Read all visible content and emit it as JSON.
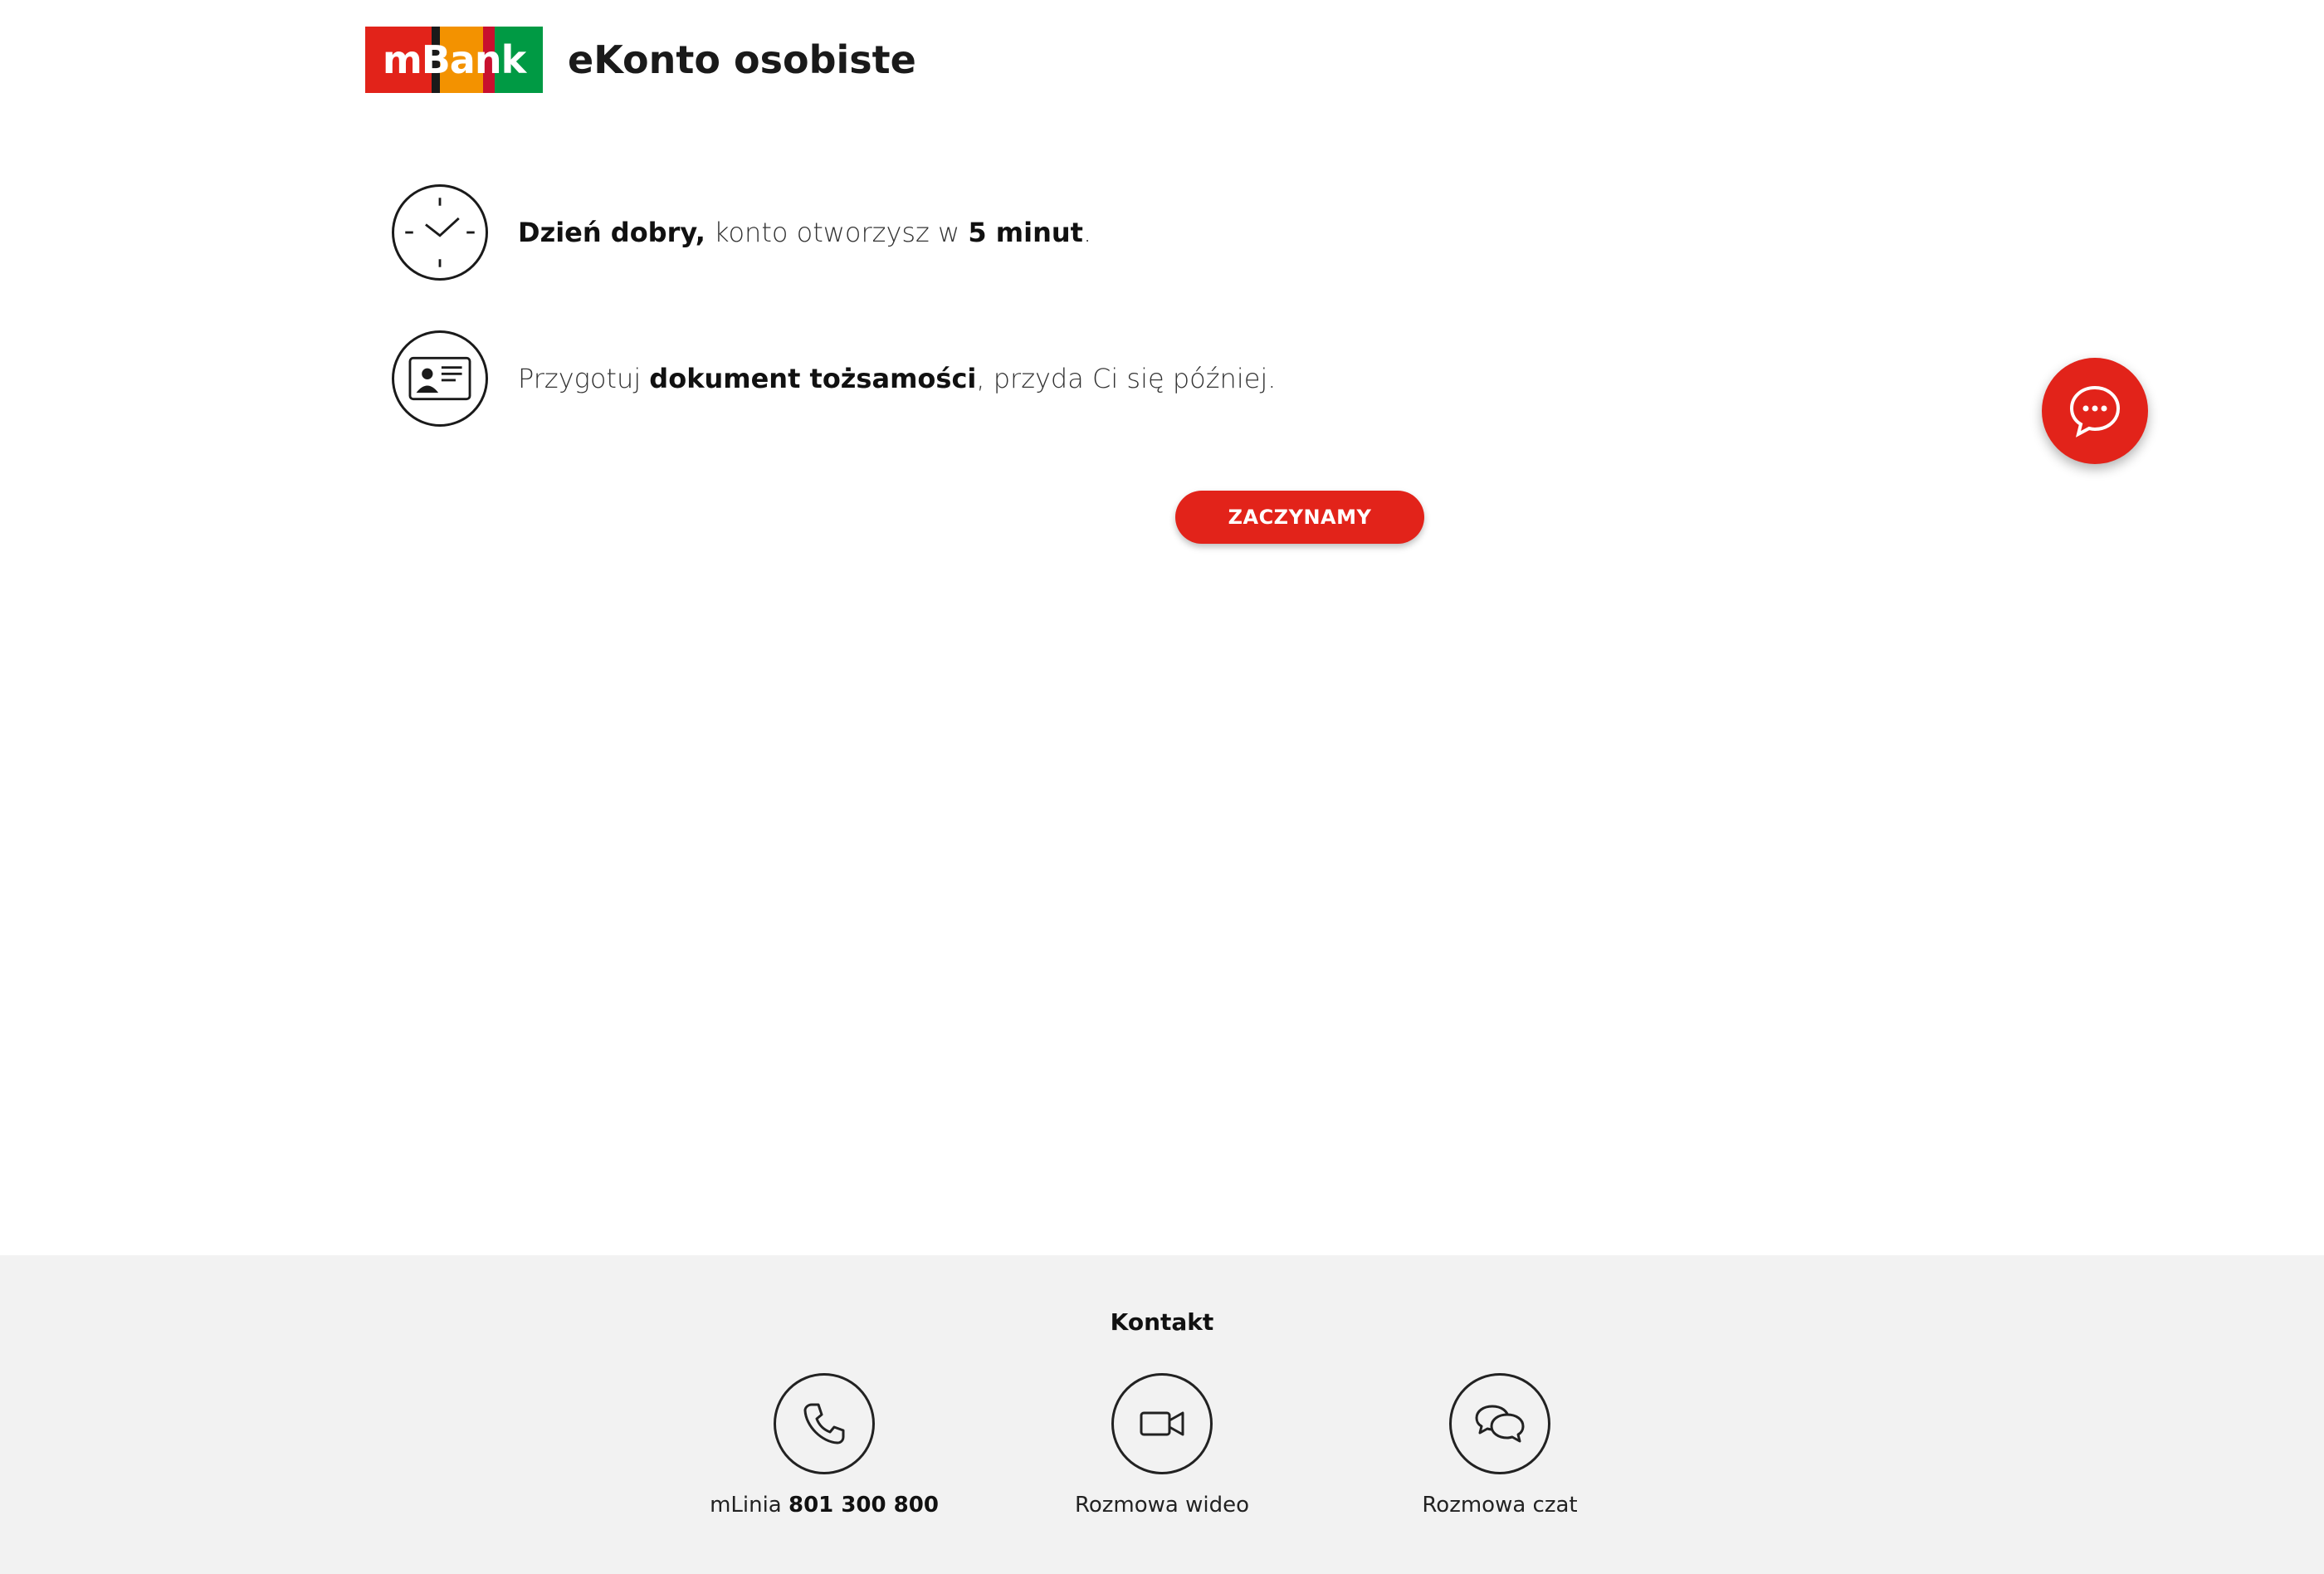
{
  "header": {
    "logo_text": "mBank",
    "product_title": "eKonto osobiste",
    "logo_colors": [
      "#e2231a",
      "#1a1a1a",
      "#f39200",
      "#c8102e",
      "#009a44"
    ]
  },
  "info": {
    "time": {
      "icon": "clock-icon",
      "bold_greeting": "Dzień dobry,",
      "middle": " konto otworzysz w ",
      "bold_duration": "5 minut",
      "end": "."
    },
    "document": {
      "icon": "id-card-icon",
      "start": "Przygotuj ",
      "bold_document": "dokument tożsamości",
      "end": ", przyda Ci się później."
    }
  },
  "cta": {
    "label": "ZACZYNAMY"
  },
  "chat_fab": {
    "icon": "chat-bubble-icon"
  },
  "footer": {
    "title": "Kontakt",
    "items": [
      {
        "icon": "phone-icon",
        "label_prefix": "mLinia ",
        "label_bold": "801 300 800"
      },
      {
        "icon": "video-camera-icon",
        "label": "Rozmowa wideo"
      },
      {
        "icon": "chat-icon",
        "label": "Rozmowa czat"
      }
    ]
  },
  "colors": {
    "brand_red": "#e2231a",
    "footer_bg": "#f2f2f2",
    "text_dark": "#1a1a1a"
  }
}
